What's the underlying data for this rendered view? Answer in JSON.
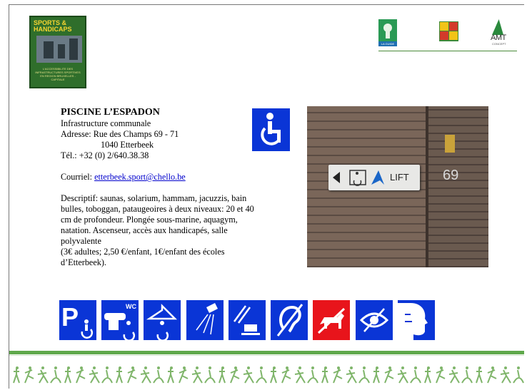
{
  "book": {
    "title_line1": "SPORTS &",
    "title_line2": "HANDICAPS",
    "subtitle": "L'ACCESSIBILITE DES INFRASTRUCTURES SPORTIVES EN REGION BRUXELLES - CAPITALE"
  },
  "logos": {
    "logo1_caption": "LA GUIDE",
    "logo3_text": "AMT",
    "logo3_small": "CONCEPT"
  },
  "venue": {
    "name": "PISCINE L’ESPADON",
    "type": "Infrastructure communale",
    "address_line1": "Adresse: Rue des Champs 69 - 71",
    "address_line2": "1040 Etterbeek",
    "phone": "Tél.: +32 (0) 2/640.38.38",
    "email_label": "Courriel: ",
    "email": "etterbeek.sport@chello.be",
    "description": [
      "Descriptif: saunas, solarium, hammam,  jacuzzis, bain",
      "bulles, toboggan, pataugeoires à deux niveaux: 20 et 40",
      "cm de profondeur. Plongée sous-marine, aquagym,",
      "natation. Ascenseur, accès aux handicapés, salle",
      "polyvalente",
      "(3€ adultes; 2,50 €/enfant, 1€/enfant des écoles",
      "d’Etterbeek)."
    ]
  },
  "photo": {
    "sign_text": "LIFT",
    "house_number": "69"
  },
  "icons": [
    {
      "name": "parking-accessible-icon",
      "color": "#0a35d6"
    },
    {
      "name": "accessible-wc-icon",
      "color": "#0a35d6",
      "label": "WC"
    },
    {
      "name": "accessible-changing-room-icon",
      "color": "#0a35d6"
    },
    {
      "name": "shower-icon",
      "color": "#0a35d6"
    },
    {
      "name": "cafeteria-icon",
      "color": "#0a35d6"
    },
    {
      "name": "hearing-impaired-icon",
      "color": "#0a35d6"
    },
    {
      "name": "no-dogs-icon",
      "color": "#e8141b"
    },
    {
      "name": "visually-impaired-icon",
      "color": "#0a35d6"
    },
    {
      "name": "speech-impaired-icon",
      "color": "#0a35d6"
    }
  ],
  "colors": {
    "accessibility_blue": "#0a35d6",
    "alert_red": "#e8141b",
    "footer_green": "#5fa84b",
    "link_blue": "#0000cc"
  }
}
